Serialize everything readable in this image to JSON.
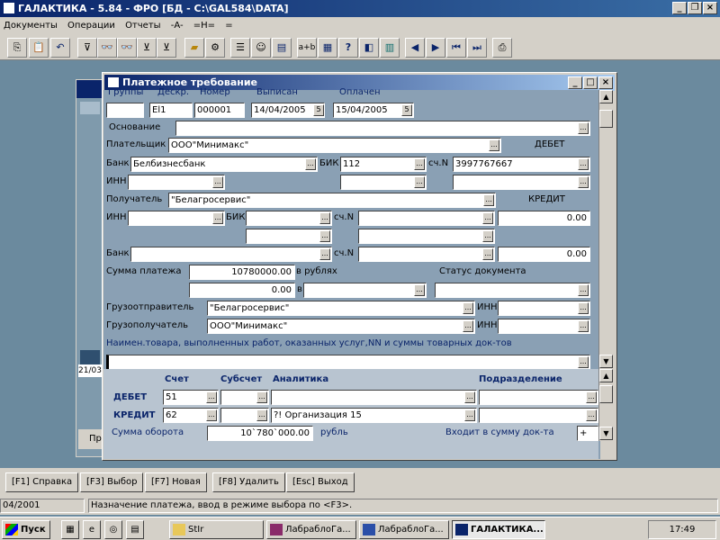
{
  "app": {
    "title": "ГАЛАКТИКА - 5.84 - ФРО [БД - C:\\GAL584\\DATA]"
  },
  "menu": [
    "Документы",
    "Операции",
    "Отчеты",
    "-A-",
    "=H=",
    "="
  ],
  "toolbar_buttons": [
    "copy",
    "paste",
    "undo",
    "filter",
    "find",
    "find-next",
    "filter-on",
    "filter-off",
    "open",
    "save",
    "list",
    "smile",
    "calc",
    "a+b",
    "calculator",
    "help",
    "split",
    "split2",
    "prev",
    "next",
    "first",
    "last",
    "print"
  ],
  "dialog": {
    "title": "Платежное требование",
    "headers": {
      "group": "Группы",
      "desc": "Дескр.",
      "number": "Номер",
      "issued": "Выписан",
      "paid": "Оплачен"
    },
    "group_value": "",
    "desc_value": "El1",
    "number_value": "000001",
    "issued_value": "14/04/2005",
    "paid_value": "15/04/2005",
    "basis_label": "Основание",
    "basis_value": "",
    "payer_label": "Плательщик",
    "payer_value": "ООО\"Минимакс\"",
    "debit_label": "ДЕБЕТ",
    "bank_label": "Банк",
    "bank_value": "Белбизнесбанк",
    "bik_label": "БИК",
    "bik_value": "112",
    "account_label": "сч.N",
    "account_value": "3997767667",
    "inn_label": "ИНН",
    "inn_value": "",
    "recipient_label": "Получатель",
    "recipient_value": "\"Белагросервис\"",
    "credit_label": "КРЕДИТ",
    "credit_amount": "0.00",
    "inn2_label": "ИНН",
    "bik2_label": "БИК",
    "account2_label": "сч.N",
    "bank2_label": "Банк",
    "account3_label": "сч.N",
    "credit_amount2": "0.00",
    "sum_label": "Сумма платежа",
    "sum_value": "10780000.00",
    "in_rub_label": "в рублях",
    "sum_value2": "0.00",
    "in_label": "в",
    "status_label": "Статус документа",
    "shipper_label": "Грузоотправитель",
    "shipper_value": "\"Белагросервис\"",
    "shipper_inn_label": "ИНН",
    "consignee_label": "Грузополучатель",
    "consignee_value": "ООО\"Минимакс\"",
    "consignee_inn_label": "ИНН",
    "goods_label": "Наимен.товара, выполненных работ, оказанных услуг,NN и суммы товарных док-тов",
    "goods_value": "",
    "col_account": "Счет",
    "col_subaccount": "Субсчет",
    "col_analytics": "Аналитика",
    "col_division": "Подразделение",
    "row_debit": "ДЕБЕТ",
    "row_credit": "КРЕДИТ",
    "debit_account": "51",
    "credit_account": "62",
    "credit_analytics": "?! Организация 15",
    "turnover_label": "Сумма оборота",
    "turnover_value": "10`780`000.00",
    "rub_label": "рубль",
    "included_label": "Входит в сумму док-та",
    "included_value": "+"
  },
  "bg_window": {
    "date_fragment": "21/03",
    "button_fragment": "Пр"
  },
  "fkeys": [
    "[F1] Справка",
    "[F3] Выбор",
    "[F7] Новая",
    "[F8] Удалить",
    "[Esc] Выход"
  ],
  "status": {
    "left": "04/2001",
    "hint": "Назначение платежа, ввод в режиме выбора по <F3>."
  },
  "taskbar": {
    "start": "Пуск",
    "items": [
      "StIr",
      "ЛабраблоГа...",
      "ЛабраблоГа...",
      "ГАЛАКТИКА..."
    ],
    "clock": "17:49"
  }
}
